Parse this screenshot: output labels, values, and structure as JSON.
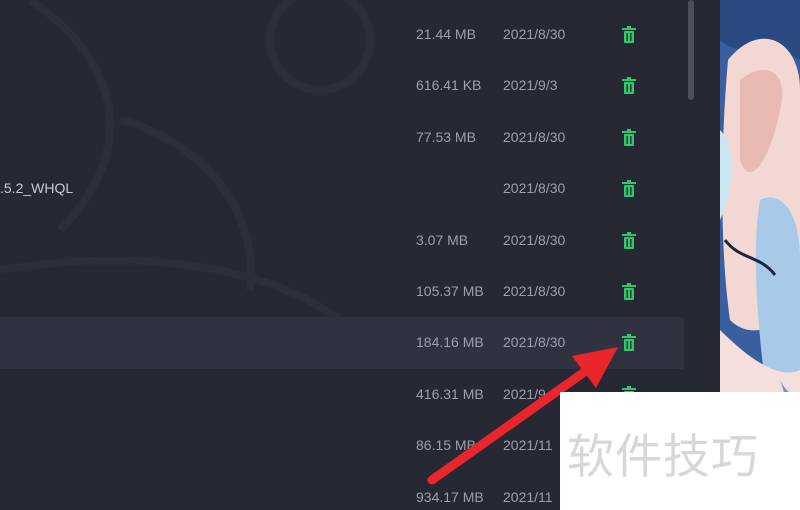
{
  "files": {
    "rows": [
      {
        "name": "",
        "size": "21.44 MB",
        "date": "2021/8/30",
        "delete_icon": "trash-icon"
      },
      {
        "name": "",
        "size": "616.41 KB",
        "date": "2021/9/3",
        "delete_icon": "trash-icon"
      },
      {
        "name": "",
        "size": "77.53 MB",
        "date": "2021/8/30",
        "delete_icon": "trash-icon"
      },
      {
        "name": ".5.2_WHQL",
        "size": "",
        "date": "2021/8/30",
        "delete_icon": "trash-icon"
      },
      {
        "name": "",
        "size": "3.07 MB",
        "date": "2021/8/30",
        "delete_icon": "trash-icon"
      },
      {
        "name": "",
        "size": "105.37 MB",
        "date": "2021/8/30",
        "delete_icon": "trash-icon"
      },
      {
        "name": "",
        "size": "184.16 MB",
        "date": "2021/8/30",
        "delete_icon": "trash-icon",
        "selected": true
      },
      {
        "name": "",
        "size": "416.31 MB",
        "date": "2021/9",
        "delete_icon": "trash-icon"
      },
      {
        "name": "",
        "size": "86.15 MB",
        "date": "2021/11",
        "delete_icon": "trash-icon"
      },
      {
        "name": "",
        "size": "934.17 MB",
        "date": "2021/11",
        "delete_icon": "trash-icon"
      }
    ]
  },
  "overlay": {
    "arrow_color": "#e8262b",
    "watermark": "软件技巧"
  },
  "colors": {
    "panel_bg": "#262934",
    "row_selected_bg": "#30333f",
    "text": "#9aa0ae",
    "delete_icon": "#2fc96b"
  }
}
